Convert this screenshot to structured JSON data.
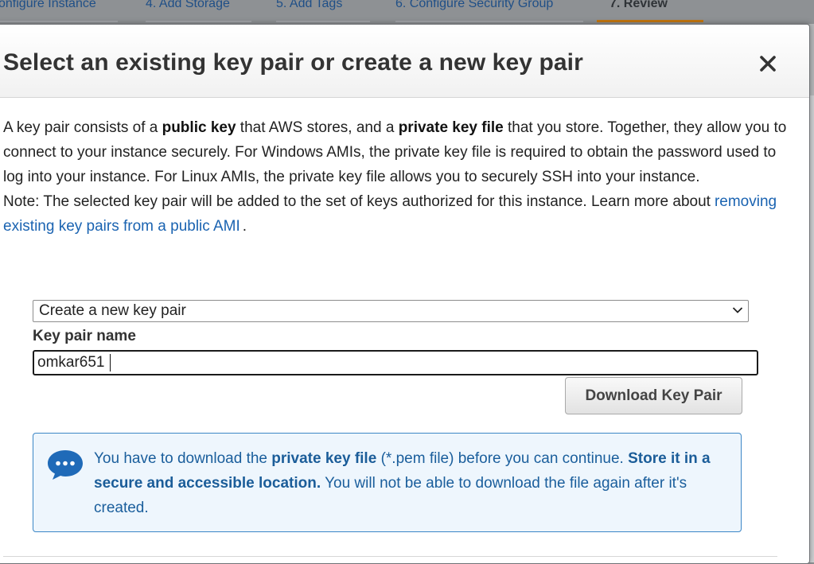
{
  "wizard_tabs": [
    {
      "label": "onfigure Instance"
    },
    {
      "label": "4. Add Storage"
    },
    {
      "label": "5. Add Tags"
    },
    {
      "label": "6. Configure Security Group"
    },
    {
      "label": "7. Review"
    }
  ],
  "modal": {
    "title": "Select an existing key pair or create a new key pair",
    "close_icon": "close-icon",
    "intro": {
      "t1": "A key pair consists of a ",
      "b1": "public key",
      "t2": " that AWS stores, and a ",
      "b2": "private key file",
      "t3": " that you store. Together, they allow you to connect to your instance securely. For Windows AMIs, the private key file is required to obtain the password used to log into your instance. For Linux AMIs, the private key file allows you to securely SSH into your instance."
    },
    "note": {
      "text": "Note: The selected key pair will be added to the set of keys authorized for this instance. Learn more about",
      "link": "removing existing key pairs from a public AMI",
      "end": "."
    },
    "key_pair_select": {
      "selected": "Create a new key pair"
    },
    "key_pair_name": {
      "label": "Key pair name",
      "value": "omkar651"
    },
    "download_button": "Download Key Pair",
    "info": {
      "icon": "chat-bubble-icon",
      "t1": "You have to download the ",
      "b1": "private key file",
      "t2": " (*.pem file) before you can continue. ",
      "b2": "Store it in a secure and accessible location.",
      "t3": " You will not be able to download the file again after it's created."
    }
  },
  "colors": {
    "accent_link": "#1a63b1",
    "info_border": "#3b86c6",
    "info_background": "#eef6fd",
    "active_tab_underline": "#c4770f"
  }
}
